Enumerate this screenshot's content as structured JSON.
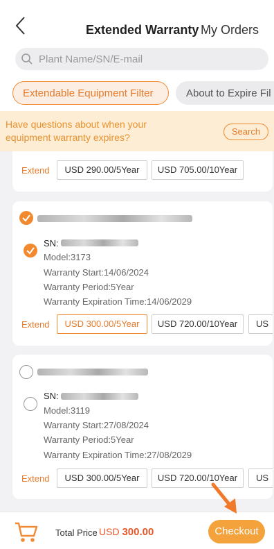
{
  "header": {
    "title": "Extended Warranty",
    "my_orders": "My Orders"
  },
  "search": {
    "placeholder": "Plant Name/SN/E-mail"
  },
  "filters": {
    "active": "Extendable Equipment Filter",
    "inactive": "About to Expire Fil"
  },
  "notice": {
    "text": "Have questions about when your equipment warranty expires?",
    "button": "Search"
  },
  "top_card": {
    "extend_label": "Extend",
    "options": [
      "USD 290.00/5Year",
      "USD 705.00/10Year"
    ]
  },
  "devices": [
    {
      "checked": true,
      "sn_label": "SN:",
      "model": "Model:3173",
      "warranty_start": "Warranty Start:14/06/2024",
      "warranty_period": "Warranty Period:5Year",
      "expiration": "Warranty Expiration Time:14/06/2029",
      "extend_label": "Extend",
      "options": [
        "USD 300.00/5Year",
        "USD 720.00/10Year",
        "US"
      ],
      "selected_option": 0
    },
    {
      "checked": false,
      "sn_label": "SN:",
      "model": "Model:3119",
      "warranty_start": "Warranty Start:27/08/2024",
      "warranty_period": "Warranty Period:5Year",
      "expiration": "Warranty Expiration Time:27/08/2029",
      "extend_label": "Extend",
      "options": [
        "USD 300.00/5Year",
        "USD 720.00/10Year",
        "US"
      ],
      "selected_option": null
    }
  ],
  "footer": {
    "total_label": "Total Price",
    "currency": "USD",
    "total_value": "300.00",
    "checkout": "Checkout"
  },
  "colors": {
    "accent": "#f08a35",
    "notice_bg": "#fcedd4",
    "checkout_bg": "#f3a23c",
    "price_red": "#e5582b"
  },
  "icons": [
    "back-chevron-icon",
    "search-icon",
    "cart-icon",
    "arrow-pointer-icon"
  ]
}
